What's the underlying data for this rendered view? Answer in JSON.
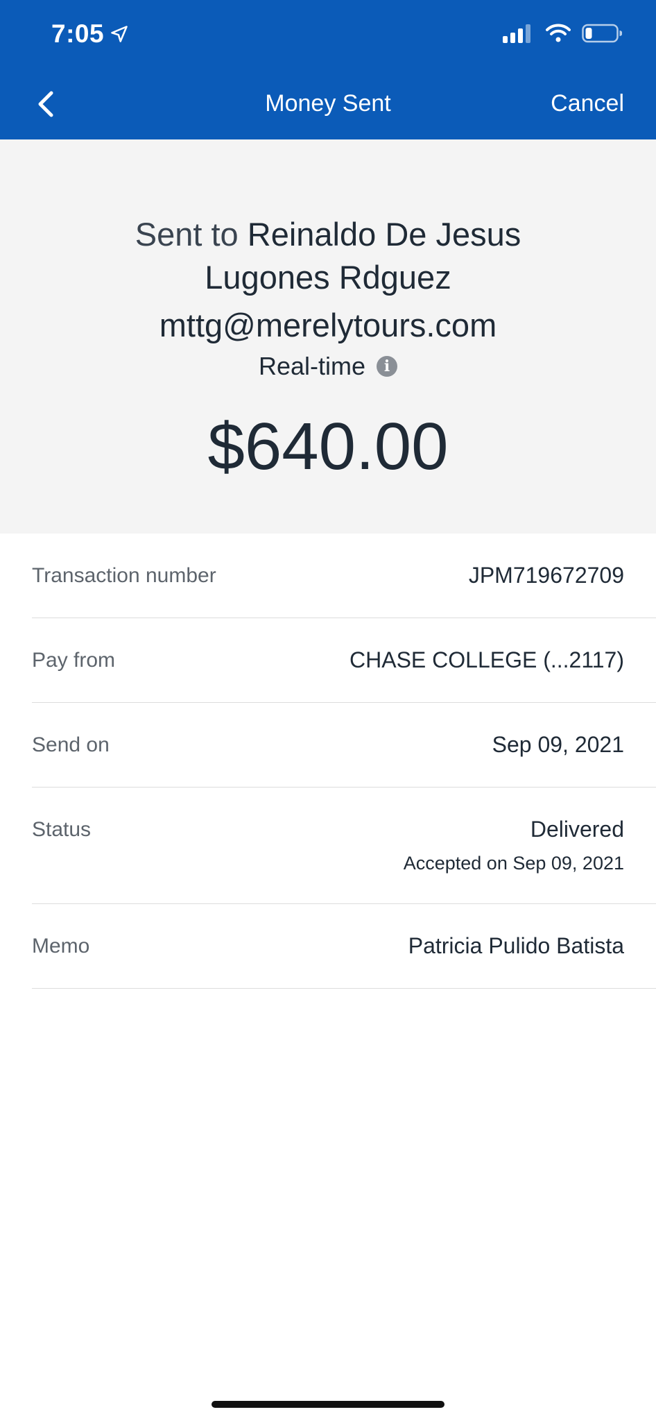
{
  "status_bar": {
    "time": "7:05"
  },
  "nav": {
    "title": "Money Sent",
    "cancel_label": "Cancel"
  },
  "summary": {
    "sent_to_prefix": "Sent to",
    "recipient_line1": "Reinaldo De Jesus",
    "recipient_line2": "Lugones Rdguez",
    "email": "mttg@merelytours.com",
    "delivery_speed": "Real-time",
    "amount": "$640.00"
  },
  "details": [
    {
      "label": "Transaction number",
      "value": "JPM719672709"
    },
    {
      "label": "Pay from",
      "value": "CHASE COLLEGE (...2117)"
    },
    {
      "label": "Send on",
      "value": "Sep 09, 2021"
    },
    {
      "label": "Status",
      "value": "Delivered",
      "sub": "Accepted on Sep 09, 2021"
    },
    {
      "label": "Memo",
      "value": "Patricia Pulido Batista"
    }
  ],
  "colors": {
    "header": "#0b5bb8",
    "summary_bg": "#f4f4f4",
    "divider": "#dcdcdc"
  }
}
